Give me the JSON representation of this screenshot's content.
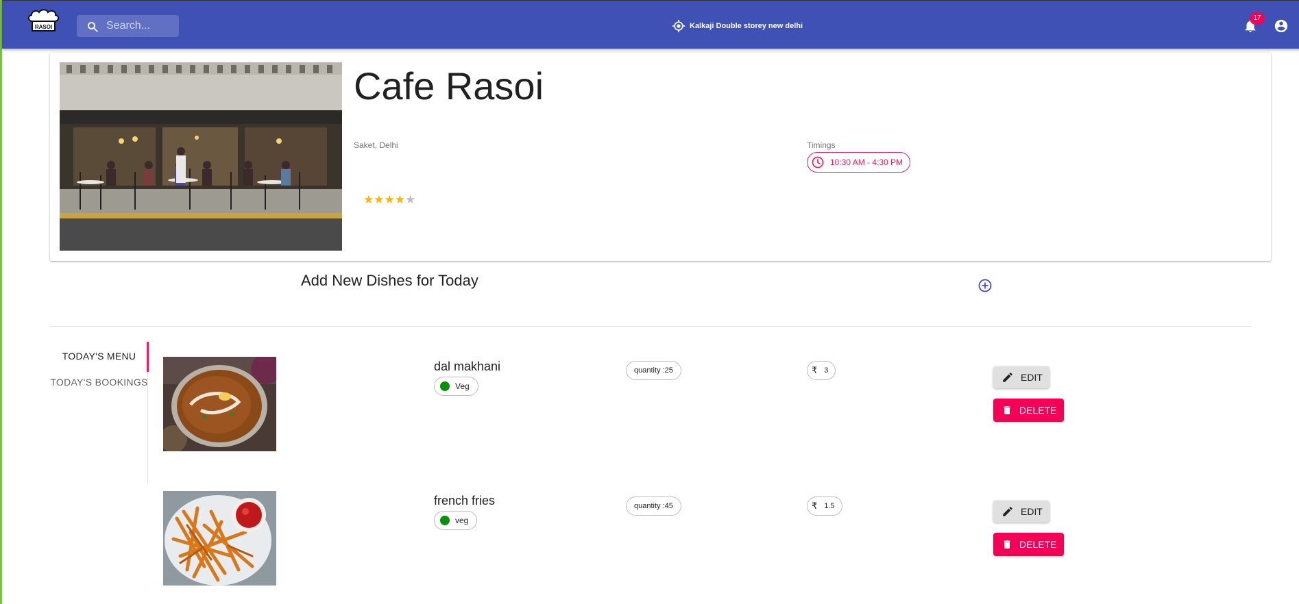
{
  "app": {
    "logo_text": "RASOI"
  },
  "search": {
    "placeholder": "Search..."
  },
  "header": {
    "location": "Kalkaji Double storey new delhi",
    "notification_count": "17"
  },
  "restaurant": {
    "name": "Cafe Rasoi",
    "location": "Saket, Delhi",
    "timings_label": "Timings",
    "timings": "10:30 AM - 4:30 PM",
    "rating": 4,
    "rating_max": 5
  },
  "add_section": {
    "title": "Add New Dishes for Today"
  },
  "tabs": [
    {
      "label": "Today's Menu"
    },
    {
      "label": "Today's Bookings"
    }
  ],
  "dishes": [
    {
      "name": "dal makhani",
      "type": "Veg",
      "quantity": "quantity :25",
      "price": "3",
      "edit": "Edit",
      "delete": "Delete"
    },
    {
      "name": "french fries",
      "type": "veg",
      "quantity": "quantity :45",
      "price": "1.5",
      "edit": "Edit",
      "delete": "Delete"
    }
  ],
  "colors": {
    "appbar": "#3f51b5",
    "accent": "#f50057",
    "timing": "#e91e63",
    "star": "#ffb400",
    "veg": "#0a8f08"
  }
}
